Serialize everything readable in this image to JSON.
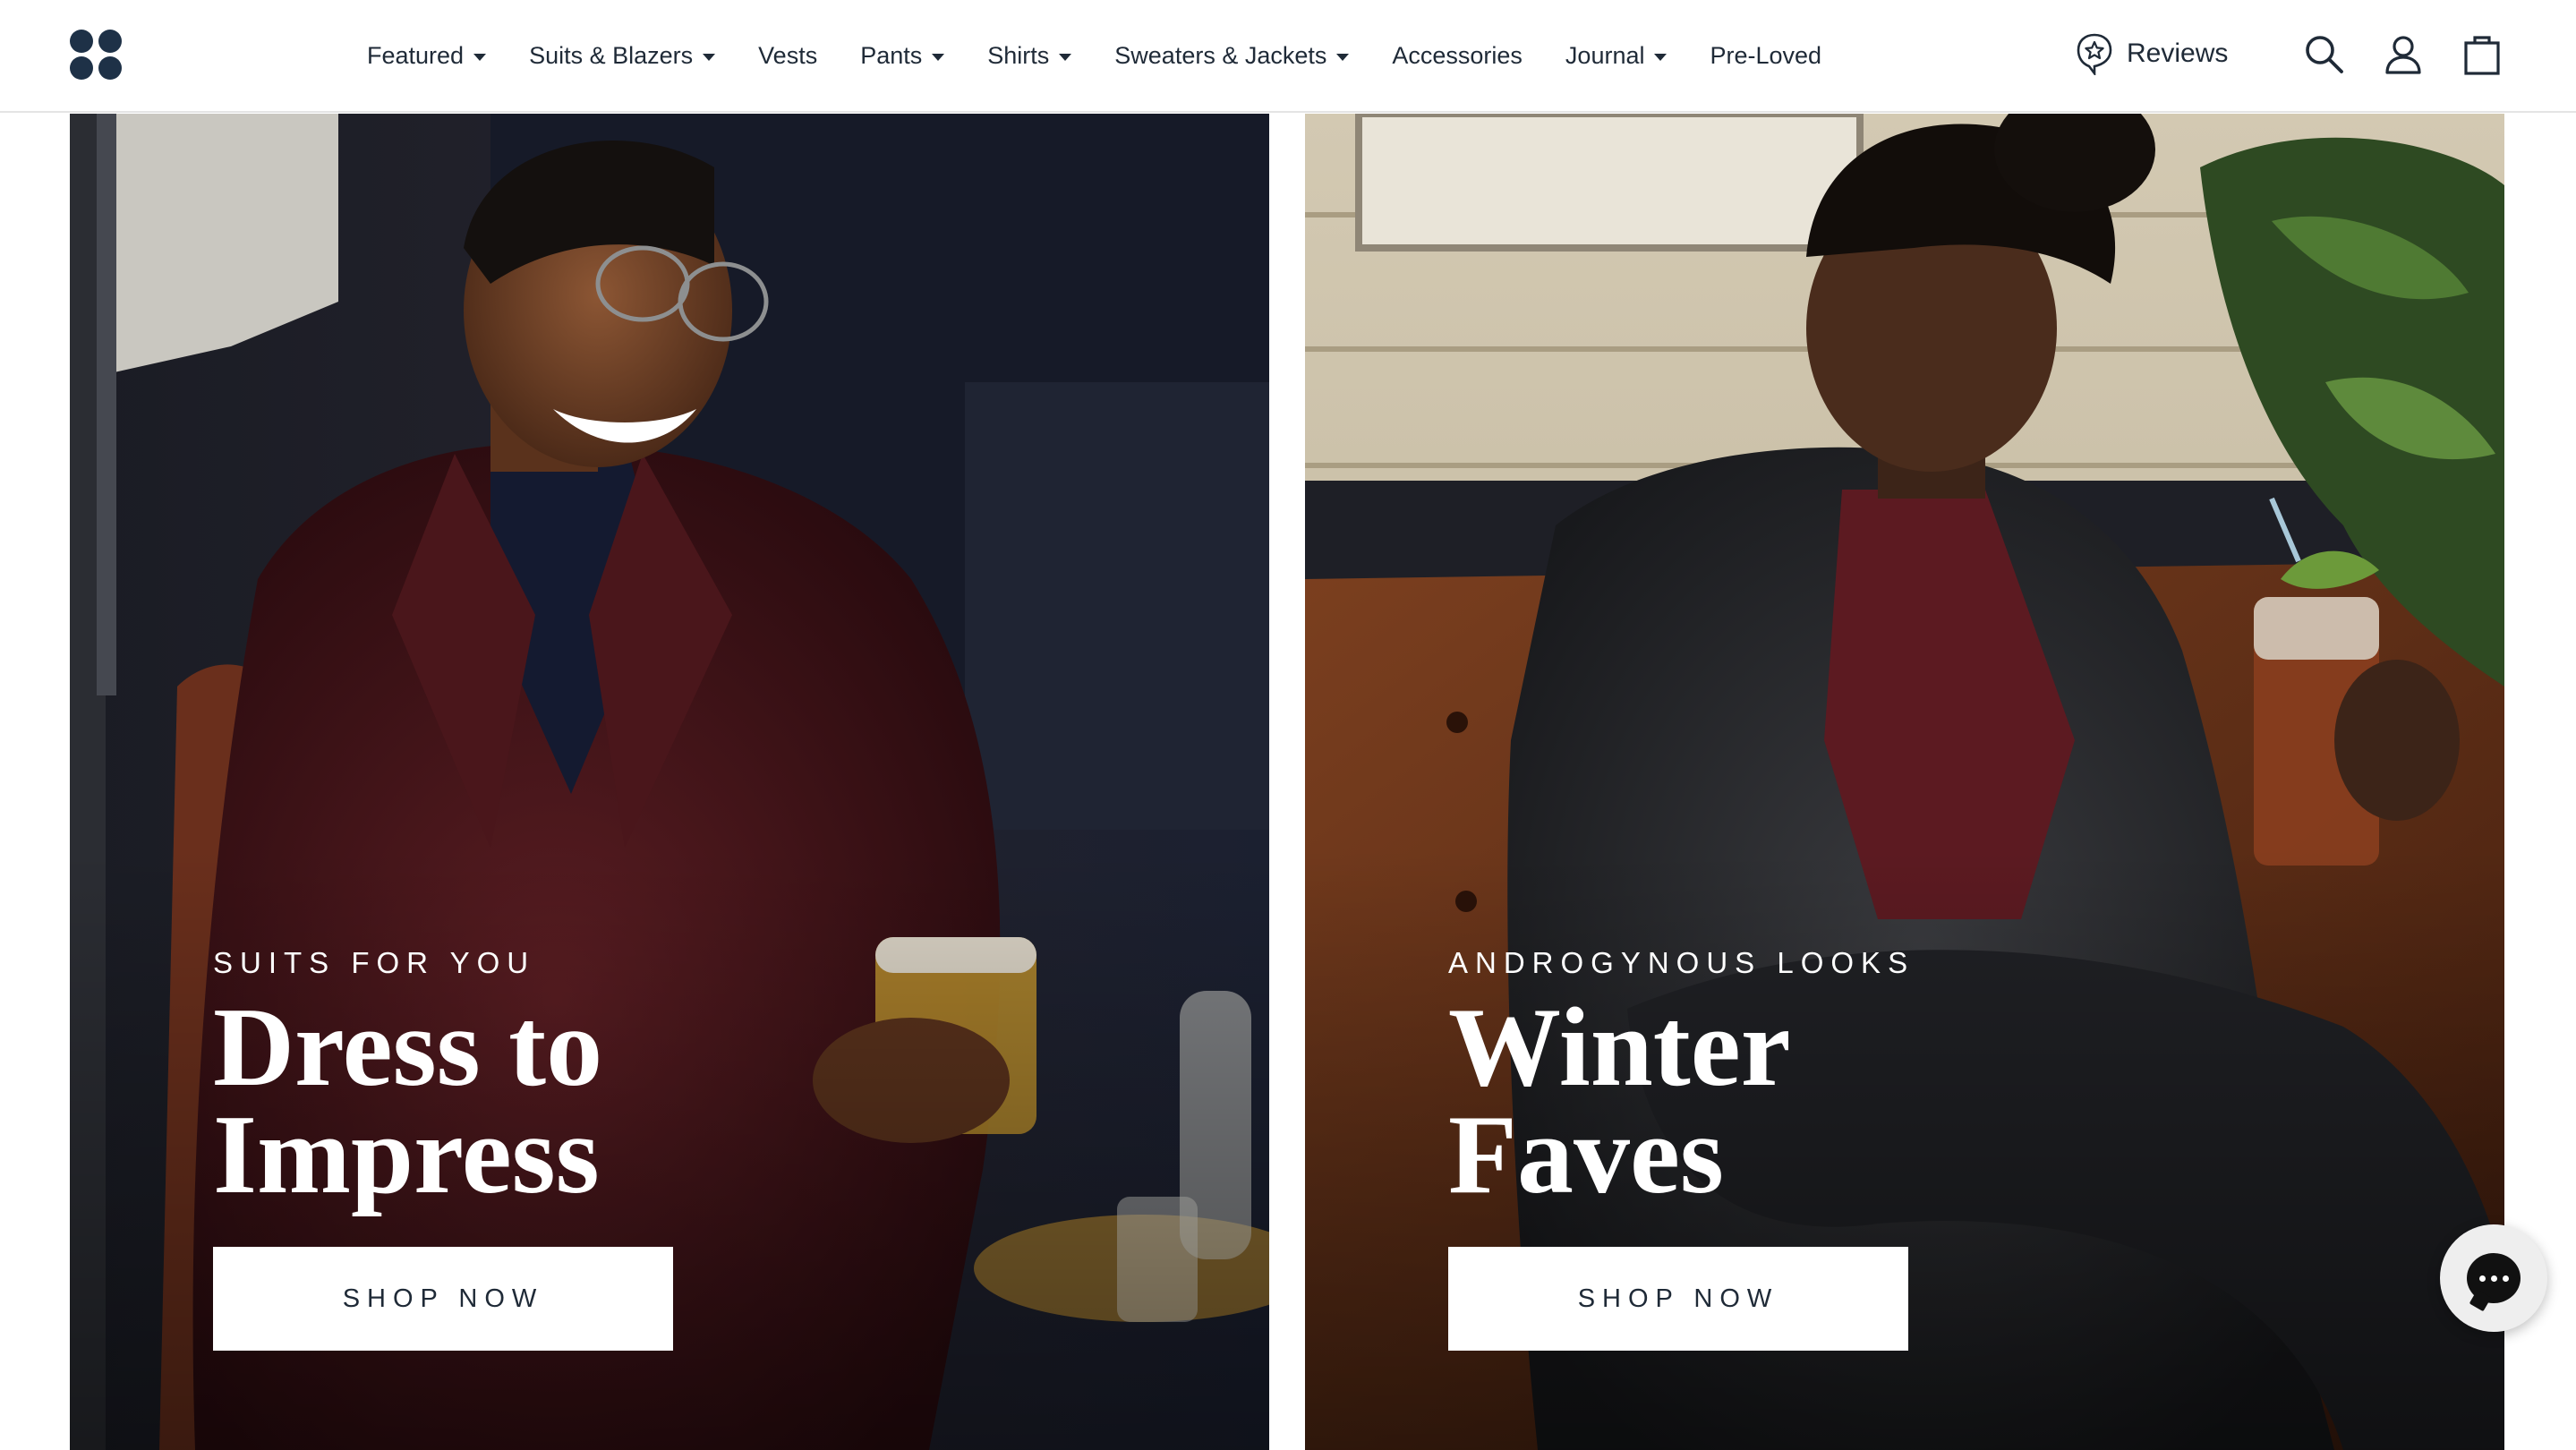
{
  "header": {
    "logo_name": "brand-logo",
    "nav": [
      {
        "label": "Featured",
        "has_dropdown": true
      },
      {
        "label": "Suits & Blazers",
        "has_dropdown": true
      },
      {
        "label": "Vests",
        "has_dropdown": false
      },
      {
        "label": "Pants",
        "has_dropdown": true
      },
      {
        "label": "Shirts",
        "has_dropdown": true
      },
      {
        "label": "Sweaters & Jackets",
        "has_dropdown": true
      },
      {
        "label": "Accessories",
        "has_dropdown": false
      },
      {
        "label": "Journal",
        "has_dropdown": true
      },
      {
        "label": "Pre-Loved",
        "has_dropdown": false
      }
    ],
    "reviews_label": "Reviews",
    "icons": [
      "reviews-badge-icon",
      "search-icon",
      "account-icon",
      "cart-bag-icon"
    ]
  },
  "promos": [
    {
      "eyebrow": "SUITS FOR YOU",
      "headline_line1": "Dress to",
      "headline_line2": "Impress",
      "button": "SHOP NOW"
    },
    {
      "eyebrow": "ANDROGYNOUS LOOKS",
      "headline_line1": "Winter",
      "headline_line2": "Faves",
      "button": "SHOP NOW"
    }
  ],
  "chat": {
    "icon": "chat-bubble-icon"
  },
  "colors": {
    "brand_navy": "#1e3147",
    "text": "#1f2a37",
    "button_bg": "#ffffff",
    "left_panel_tone": "#3a1416",
    "right_panel_tone": "#2a1a12"
  }
}
